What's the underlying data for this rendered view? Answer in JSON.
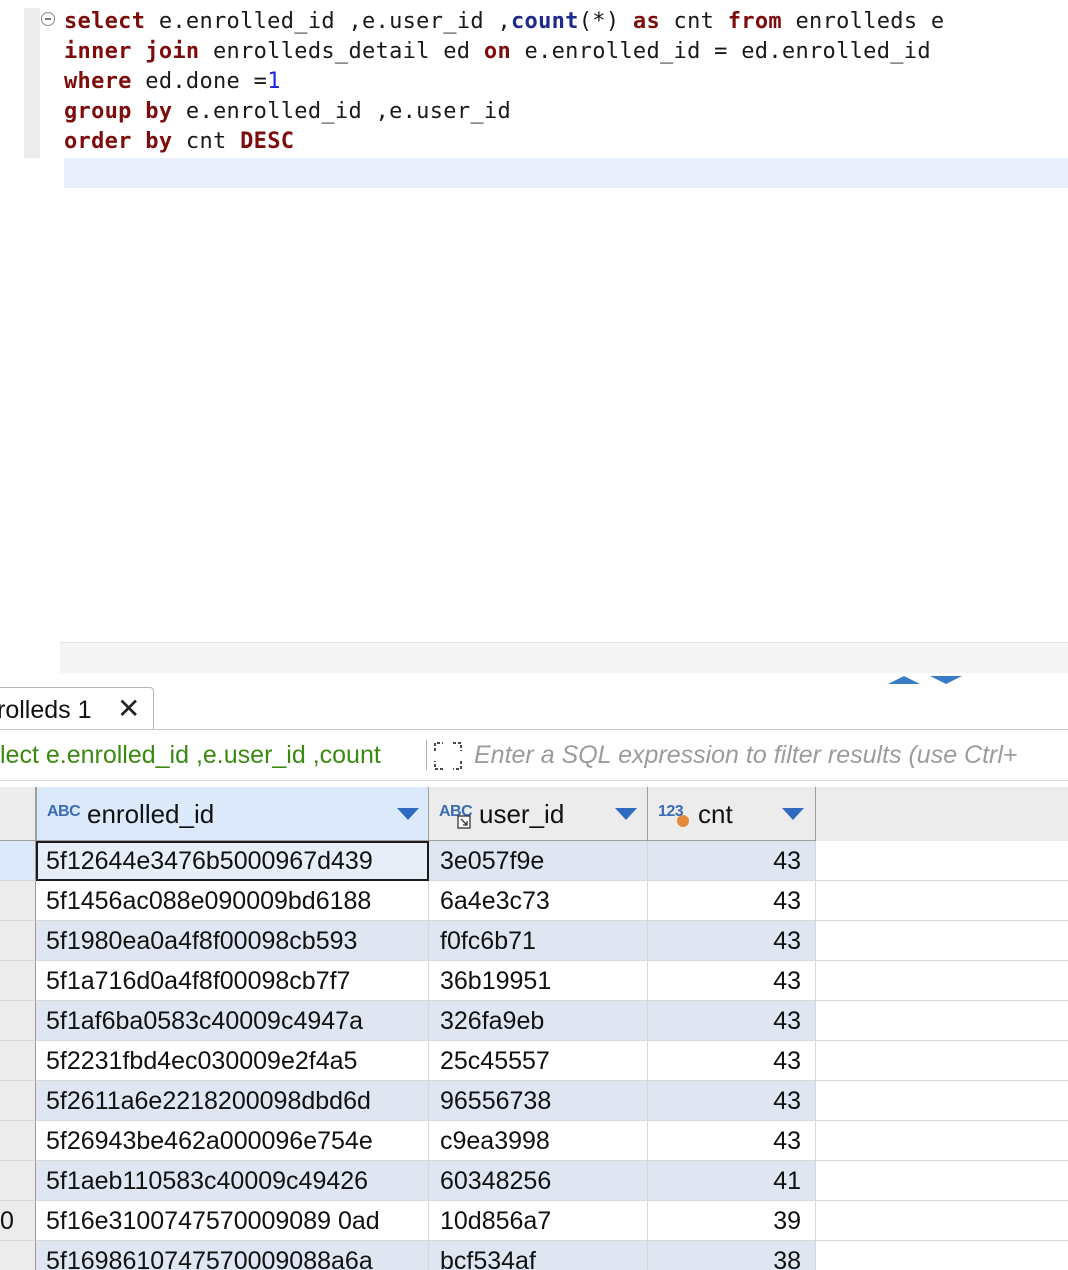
{
  "editor": {
    "lines": [
      [
        {
          "t": "select",
          "c": "kw"
        },
        {
          "t": " e.enrolled_id ,e.user_id ,",
          "c": ""
        },
        {
          "t": "count",
          "c": "fn"
        },
        {
          "t": "(*) ",
          "c": ""
        },
        {
          "t": "as",
          "c": "kw"
        },
        {
          "t": " cnt ",
          "c": ""
        },
        {
          "t": "from",
          "c": "kw"
        },
        {
          "t": " enrolleds e",
          "c": ""
        }
      ],
      [
        {
          "t": "inner join",
          "c": "kw"
        },
        {
          "t": " enrolleds_detail ed ",
          "c": ""
        },
        {
          "t": "on",
          "c": "kw"
        },
        {
          "t": " e.enrolled_id = ed.enrolled_id",
          "c": ""
        }
      ],
      [
        {
          "t": "where",
          "c": "kw"
        },
        {
          "t": " ed.done =",
          "c": ""
        },
        {
          "t": "1",
          "c": "num"
        }
      ],
      [
        {
          "t": "group by",
          "c": "kw"
        },
        {
          "t": " e.enrolled_id ,e.user_id",
          "c": ""
        }
      ],
      [
        {
          "t": "order by",
          "c": "kw"
        },
        {
          "t": " cnt ",
          "c": ""
        },
        {
          "t": "DESC",
          "c": "kw"
        }
      ]
    ]
  },
  "results_tab": {
    "label": "rolleds 1",
    "close_icon": "close-icon"
  },
  "filter": {
    "query_preview": "lect e.enrolled_id ,e.user_id ,count",
    "placeholder": "Enter a SQL expression to filter results (use Ctrl+",
    "expand_icon": "expand-icon"
  },
  "grid": {
    "columns": [
      {
        "type_label": "ABC",
        "name": "enrolled_id"
      },
      {
        "type_label": "ABC",
        "name": "user_id"
      },
      {
        "type_label": "123",
        "name": "cnt"
      }
    ],
    "row_numbers": [
      "",
      "",
      "",
      "",
      "",
      "",
      "",
      "",
      "",
      "0",
      ""
    ],
    "rows": [
      [
        "5f12644e3476b5000967d439",
        "3e057f9e",
        "43"
      ],
      [
        "5f1456ac088e090009bd6188",
        "6a4e3c73",
        "43"
      ],
      [
        "5f1980ea0a4f8f00098cb593",
        "f0fc6b71",
        "43"
      ],
      [
        "5f1a716d0a4f8f00098cb7f7",
        "36b19951",
        "43"
      ],
      [
        "5f1af6ba0583c40009c4947a",
        "326fa9eb",
        "43"
      ],
      [
        "5f2231fbd4ec030009e2f4a5",
        "25c45557",
        "43"
      ],
      [
        "5f2611a6e2218200098dbd6d",
        "96556738",
        "43"
      ],
      [
        "5f26943be462a000096e754e",
        "c9ea3998",
        "43"
      ],
      [
        "5f1aeb110583c40009c49426",
        "60348256",
        "41"
      ],
      [
        "5f16e3100747570009089 0ad",
        "10d856a7",
        "39"
      ],
      [
        "5f1698610747570009088a6a",
        "bcf534af",
        "38"
      ]
    ]
  },
  "colors": {
    "keyword": "#7f0c0c",
    "function": "#1d2a8c",
    "number": "#1a25e0",
    "query_preview": "#3b8a10",
    "accent": "#2f6bc1"
  }
}
